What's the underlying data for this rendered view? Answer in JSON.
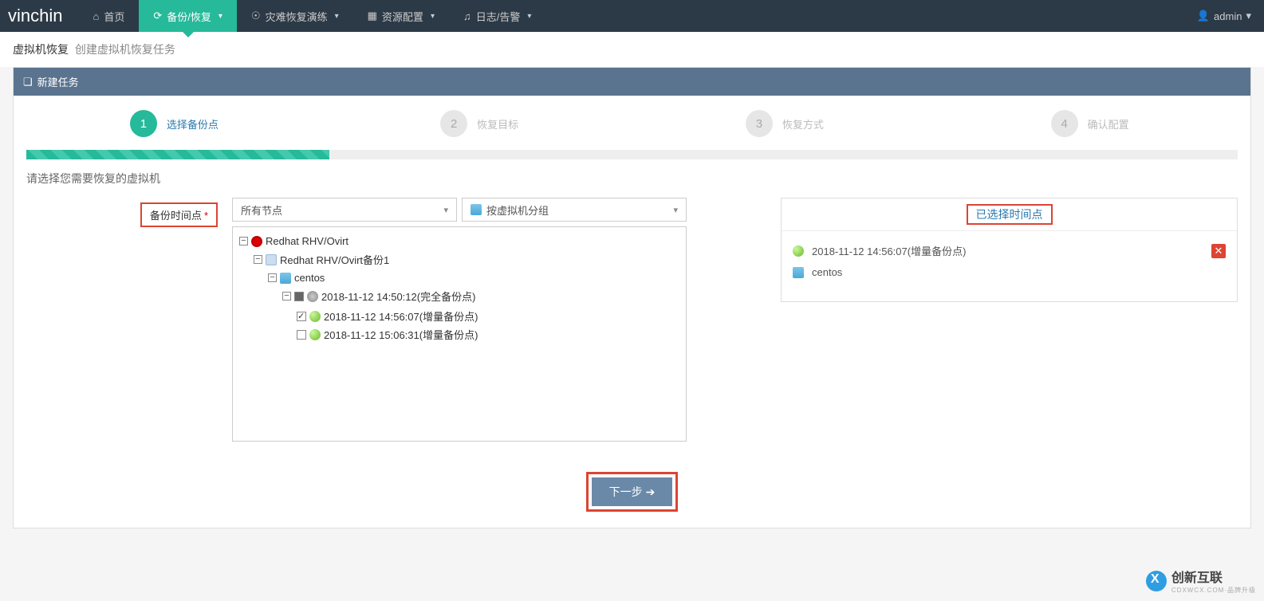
{
  "brand": "vinchin",
  "nav": {
    "home": "首页",
    "backup": "备份/恢复",
    "drill": "灾难恢复演练",
    "resource": "资源配置",
    "log": "日志/告警"
  },
  "user": {
    "name": "admin"
  },
  "breadcrumb": {
    "a": "虚拟机恢复",
    "b": "创建虚拟机恢复任务"
  },
  "panel_title": "新建任务",
  "wizard": {
    "s1": {
      "num": "1",
      "label": "选择备份点"
    },
    "s2": {
      "num": "2",
      "label": "恢复目标"
    },
    "s3": {
      "num": "3",
      "label": "恢复方式"
    },
    "s4": {
      "num": "4",
      "label": "确认配置"
    }
  },
  "prompt": "请选择您需要恢复的虚拟机",
  "label_backup_point": "备份时间点",
  "select_node": "所有节点",
  "select_group": "按虚拟机分组",
  "tree": {
    "root": "Redhat RHV/Ovirt",
    "job": "Redhat RHV/Ovirt备份1",
    "vm": "centos",
    "full": "2018-11-12 14:50:12(完全备份点)",
    "inc1": "2018-11-12 14:56:07(增量备份点)",
    "inc2": "2018-11-12 15:06:31(增量备份点)"
  },
  "right_title": "已选择时间点",
  "right": {
    "point": "2018-11-12 14:56:07(增量备份点)",
    "vm": "centos"
  },
  "next": "下一步",
  "watermark": {
    "text": "创新互联",
    "sub": "CDXWCX.COM·品牌升级"
  }
}
